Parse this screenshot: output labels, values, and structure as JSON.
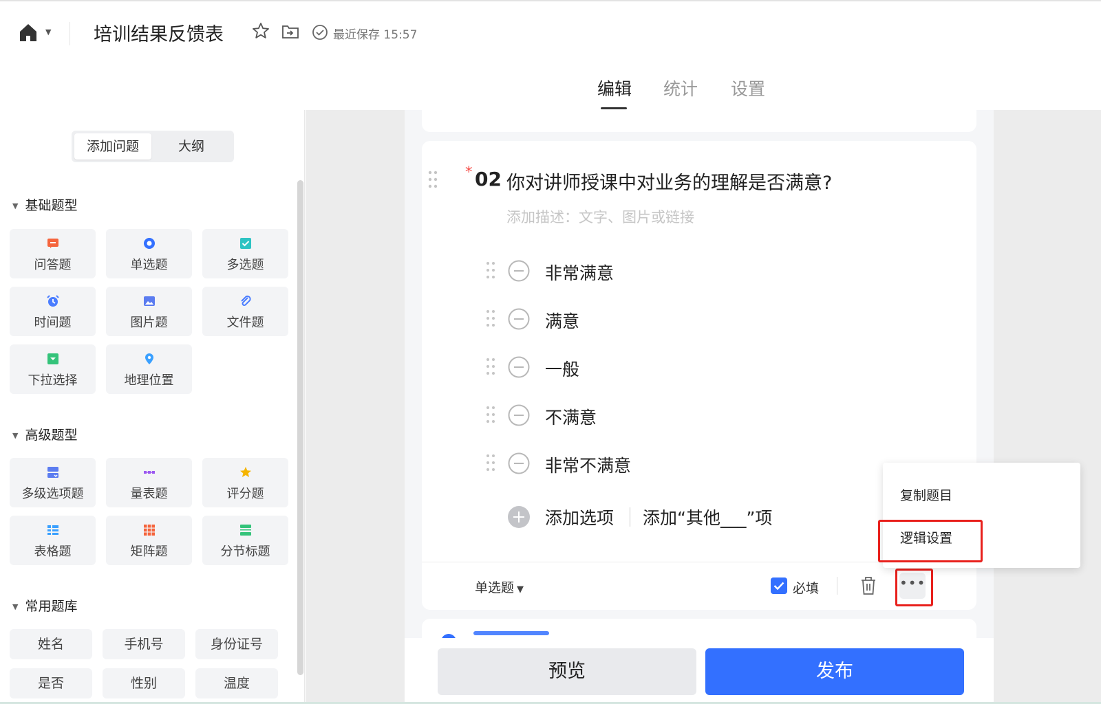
{
  "header": {
    "doc_title": "培训结果反馈表",
    "save_status": "最近保存 15:57",
    "tabs": [
      {
        "label": "编辑",
        "active": true
      },
      {
        "label": "统计",
        "active": false
      },
      {
        "label": "设置",
        "active": false
      }
    ]
  },
  "sidebar": {
    "segment": {
      "add_question": "添加问题",
      "outline": "大纲"
    },
    "basic": {
      "title": "基础题型",
      "items": [
        {
          "label": "问答题",
          "icon": "qa-icon",
          "color": "#f5643c"
        },
        {
          "label": "单选题",
          "icon": "radio-icon",
          "color": "#3370ff"
        },
        {
          "label": "多选题",
          "icon": "checkbox-icon",
          "color": "#2dc3c3"
        },
        {
          "label": "时间题",
          "icon": "alarm-clock-icon",
          "color": "#4a7dff"
        },
        {
          "label": "图片题",
          "icon": "image-icon",
          "color": "#5b7cf0"
        },
        {
          "label": "文件题",
          "icon": "paperclip-icon",
          "color": "#4a7dff"
        },
        {
          "label": "下拉选择",
          "icon": "dropdown-icon",
          "color": "#34c37a"
        },
        {
          "label": "地理位置",
          "icon": "location-pin-icon",
          "color": "#3aa0ff"
        }
      ]
    },
    "advanced": {
      "title": "高级题型",
      "items": [
        {
          "label": "多级选项题",
          "icon": "cascade-icon",
          "color": "#5b7cf0"
        },
        {
          "label": "量表题",
          "icon": "scale-icon",
          "color": "#9b59f0"
        },
        {
          "label": "评分题",
          "icon": "star-icon",
          "color": "#f5b400"
        },
        {
          "label": "表格题",
          "icon": "table-icon",
          "color": "#3aa0ff"
        },
        {
          "label": "矩阵题",
          "icon": "matrix-icon",
          "color": "#f5643c"
        },
        {
          "label": "分节标题",
          "icon": "section-icon",
          "color": "#34c37a"
        }
      ]
    },
    "library": {
      "title": "常用题库",
      "items": [
        "姓名",
        "手机号",
        "身份证号",
        "是否",
        "性别",
        "温度"
      ]
    }
  },
  "question": {
    "required_mark": "*",
    "number": "02",
    "title": "你对讲师授课中对业务的理解是否满意?",
    "description_placeholder": "添加描述：文字、图片或链接",
    "options": [
      "非常满意",
      "满意",
      "一般",
      "不满意",
      "非常不满意"
    ],
    "add_option": "添加选项",
    "add_other": "添加“其他___”项",
    "type_label": "单选题",
    "required_label": "必填"
  },
  "more_menu": {
    "copy": "复制题目",
    "logic": "逻辑设置"
  },
  "bottom": {
    "preview": "预览",
    "publish": "发布"
  },
  "colors": {
    "accent": "#3370ff",
    "highlight": "#e8201c"
  }
}
